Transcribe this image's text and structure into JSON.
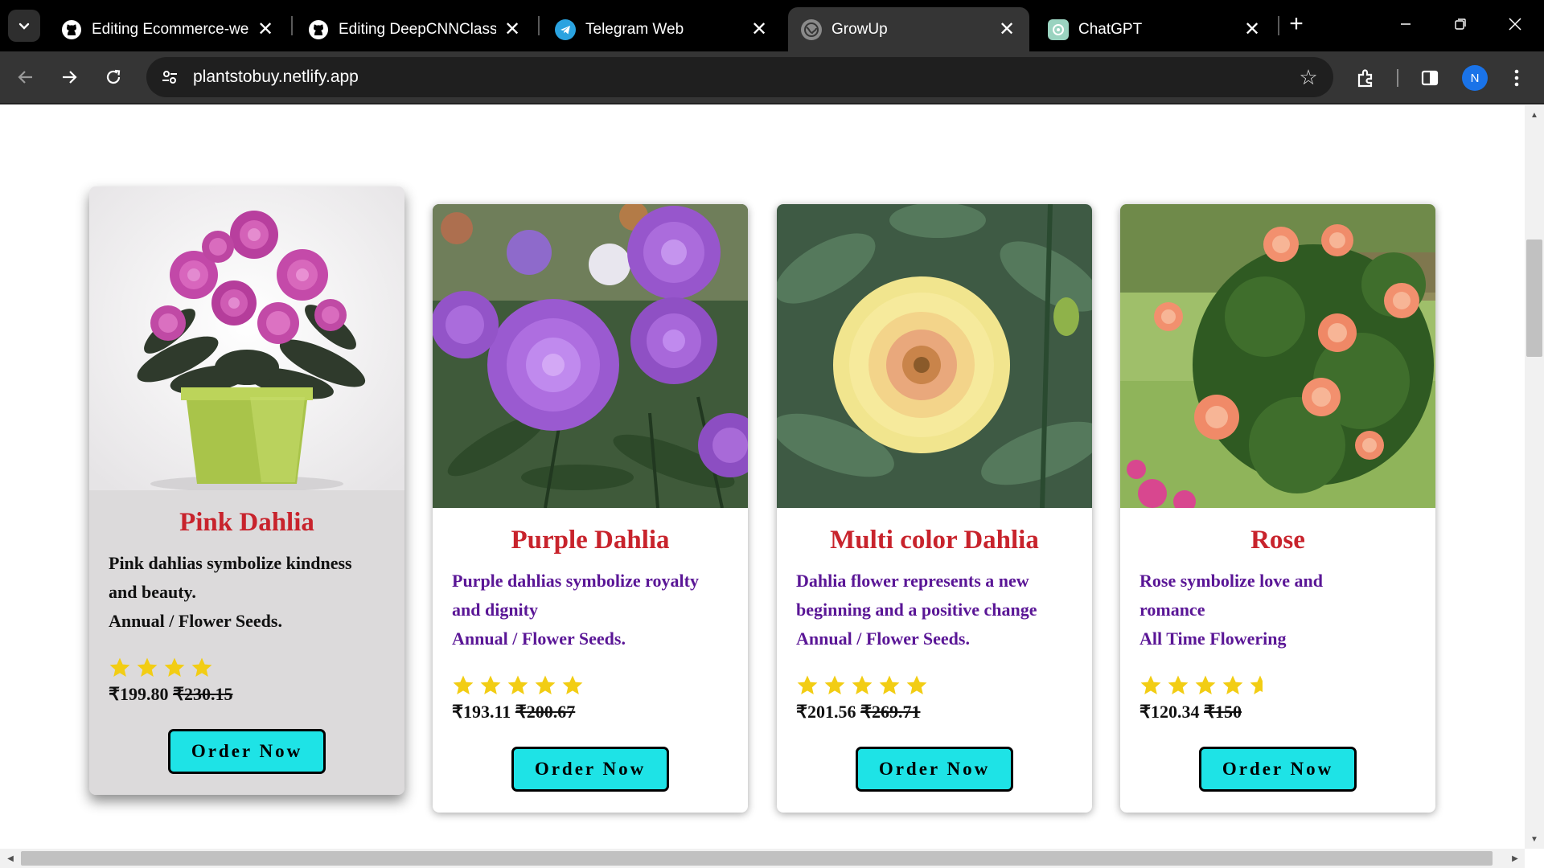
{
  "browser": {
    "tabs": [
      {
        "title": "Editing Ecommerce-webs",
        "icon": "github-icon",
        "active": false
      },
      {
        "title": "Editing DeepCNNClassific",
        "icon": "github-icon",
        "active": false
      },
      {
        "title": "Telegram Web",
        "icon": "telegram-icon",
        "active": false
      },
      {
        "title": "GrowUp",
        "icon": "globe-icon",
        "active": true
      },
      {
        "title": "ChatGPT",
        "icon": "chatgpt-icon",
        "active": false
      }
    ],
    "close_glyph": "✕",
    "new_tab_glyph": "+",
    "url": "plantstobuy.netlify.app",
    "profile_initial": "N"
  },
  "colors": {
    "title_red": "#c8232c",
    "desc_purple": "#5a1696",
    "button_cyan": "#1ee3e6",
    "star_yellow": "#f2cd14",
    "hover_card_bg": "#dcdadb"
  },
  "products": [
    {
      "title": "Pink Dahlia",
      "desc_line1": "Pink dahlias symbolize kindness",
      "desc_line2": "and beauty.",
      "desc_line3": "Annual / Flower Seeds.",
      "rating": 4,
      "price": "₹199.80",
      "old_price": "₹230.15",
      "button": "Order Now",
      "image": "pink-dahlia-in-pot"
    },
    {
      "title": "Purple Dahlia",
      "desc_line1": "Purple dahlias symbolize royalty",
      "desc_line2": "and dignity",
      "desc_line3": "Annual / Flower Seeds.",
      "rating": 5,
      "price": "₹193.11",
      "old_price": "₹200.67",
      "button": "Order Now",
      "image": "purple-dahlias"
    },
    {
      "title": "Multi color Dahlia",
      "desc_line1": "Dahlia flower represents a new",
      "desc_line2": "beginning and a positive change",
      "desc_line3": "Annual / Flower Seeds.",
      "rating": 5,
      "price": "₹201.56",
      "old_price": "₹269.71",
      "button": "Order Now",
      "image": "multicolor-dahlia"
    },
    {
      "title": "Rose",
      "desc_line1": "Rose symbolize love and",
      "desc_line2": "romance",
      "desc_line3": "All Time Flowering",
      "rating": 4.5,
      "price": "₹120.34",
      "old_price": "₹150",
      "button": "Order Now",
      "image": "peach-rose-bush"
    }
  ]
}
